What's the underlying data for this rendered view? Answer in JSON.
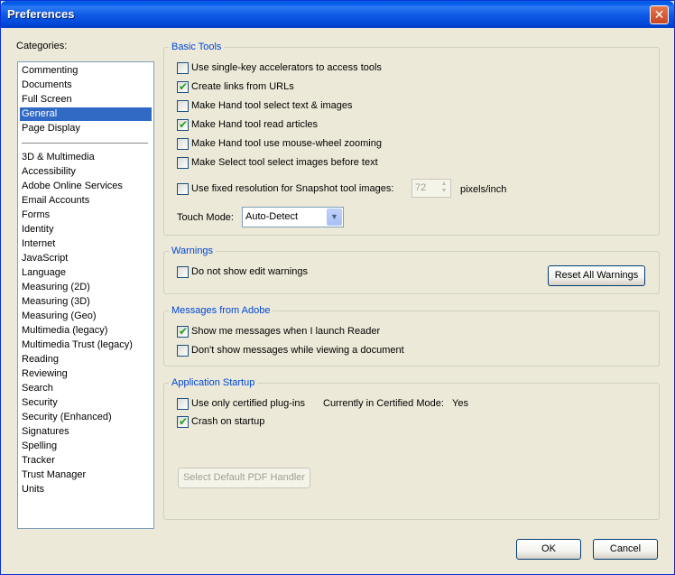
{
  "window": {
    "title": "Preferences",
    "close_label": "✕"
  },
  "categories": {
    "label": "Categories:",
    "top_items": [
      "Commenting",
      "Documents",
      "Full Screen",
      "General",
      "Page Display"
    ],
    "selected": "General",
    "items": [
      "3D & Multimedia",
      "Accessibility",
      "Adobe Online Services",
      "Email Accounts",
      "Forms",
      "Identity",
      "Internet",
      "JavaScript",
      "Language",
      "Measuring (2D)",
      "Measuring (3D)",
      "Measuring (Geo)",
      "Multimedia (legacy)",
      "Multimedia Trust (legacy)",
      "Reading",
      "Reviewing",
      "Search",
      "Security",
      "Security (Enhanced)",
      "Signatures",
      "Spelling",
      "Tracker",
      "Trust Manager",
      "Units"
    ]
  },
  "basic_tools": {
    "title": "Basic Tools",
    "options": [
      {
        "label": "Use single-key accelerators to access tools",
        "checked": false
      },
      {
        "label": "Create links from URLs",
        "checked": true
      },
      {
        "label": "Make Hand tool select text & images",
        "checked": false
      },
      {
        "label": "Make Hand tool read articles",
        "checked": true
      },
      {
        "label": "Make Hand tool use mouse-wheel zooming",
        "checked": false
      },
      {
        "label": "Make Select tool select images before text",
        "checked": false
      }
    ],
    "snapshot_label": "Use fixed resolution for Snapshot tool images:",
    "snapshot_checked": false,
    "snapshot_value": "72",
    "snapshot_unit": "pixels/inch",
    "touch_mode_label": "Touch Mode:",
    "touch_mode_value": "Auto-Detect"
  },
  "warnings": {
    "title": "Warnings",
    "option": {
      "label": "Do not show edit warnings",
      "checked": false
    },
    "reset_label": "Reset All Warnings"
  },
  "messages": {
    "title": "Messages from Adobe",
    "options": [
      {
        "label": "Show me messages when I launch Reader",
        "checked": true
      },
      {
        "label": "Don't show messages while viewing a document",
        "checked": false
      }
    ]
  },
  "startup": {
    "title": "Application Startup",
    "certified_label": "Use only certified plug-ins",
    "certified_checked": false,
    "certified_mode_label": "Currently in Certified Mode:",
    "certified_mode_value": "Yes",
    "crash_label": "Crash on startup",
    "crash_checked": true,
    "default_handler_label": "Select Default PDF Handler"
  },
  "footer": {
    "ok_label": "OK",
    "cancel_label": "Cancel"
  },
  "colors": {
    "selection": "#316ac5",
    "group_title": "#0046d5",
    "checkmark": "#21a121"
  }
}
